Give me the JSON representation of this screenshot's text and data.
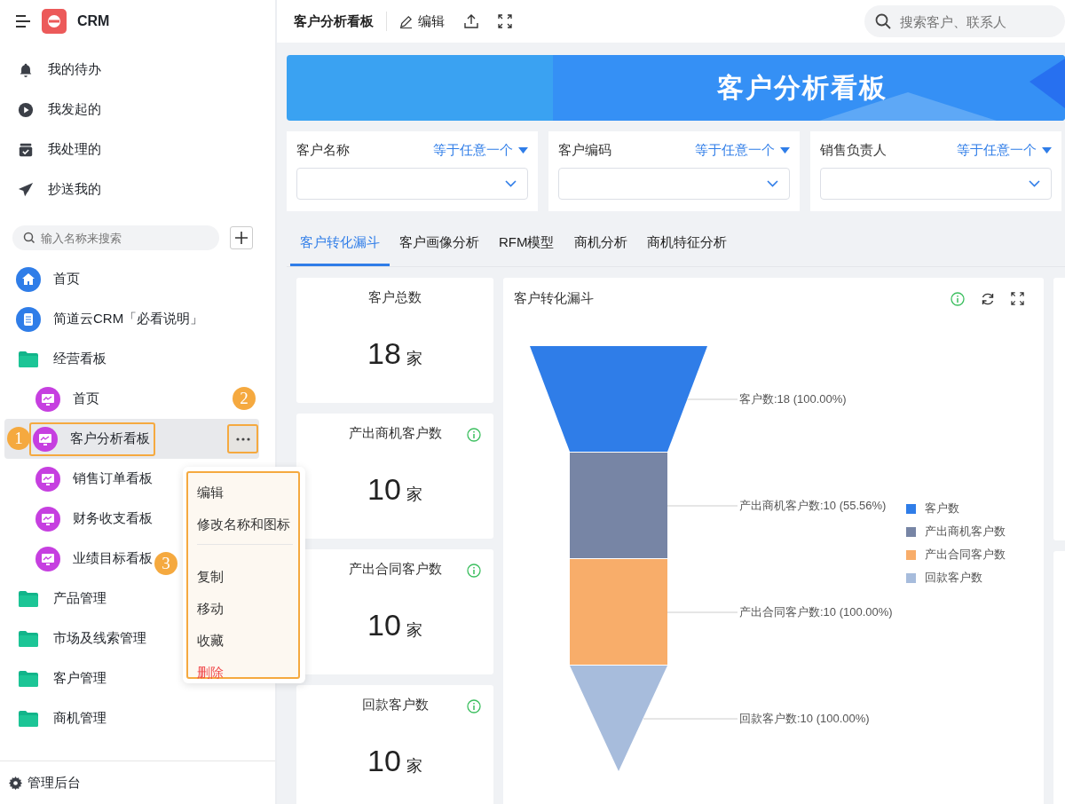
{
  "sidebar": {
    "app_name": "CRM",
    "quick_items": [
      {
        "label": "我的待办"
      },
      {
        "label": "我发起的"
      },
      {
        "label": "我处理的"
      },
      {
        "label": "抄送我的"
      }
    ],
    "search": {
      "placeholder": "输入名称来搜索"
    },
    "tree": [
      {
        "label": "首页",
        "kind": "home",
        "selected": false
      },
      {
        "label": "简道云CRM「必看说明」",
        "kind": "document",
        "selected": false
      },
      {
        "label": "经营看板",
        "kind": "folder",
        "selected": false,
        "children": [
          {
            "label": "首页",
            "kind": "board",
            "selected": false
          },
          {
            "label": "客户分析看板",
            "kind": "board",
            "selected": true,
            "callout": "1",
            "more_callout": "2"
          },
          {
            "label": "销售订单看板",
            "kind": "board",
            "selected": false
          },
          {
            "label": "财务收支看板",
            "kind": "board",
            "selected": false
          },
          {
            "label": "业绩目标看板",
            "kind": "board",
            "selected": false
          }
        ]
      },
      {
        "label": "产品管理",
        "kind": "folder",
        "selected": false
      },
      {
        "label": "市场及线索管理",
        "kind": "folder",
        "selected": false
      },
      {
        "label": "客户管理",
        "kind": "folder",
        "selected": false
      },
      {
        "label": "商机管理",
        "kind": "folder",
        "selected": false
      }
    ],
    "footer": "管理后台"
  },
  "context_menu": {
    "callout": "3",
    "items": [
      {
        "label": "编辑",
        "kind": "normal"
      },
      {
        "label": "修改名称和图标",
        "kind": "normal"
      },
      {
        "kind": "divider"
      },
      {
        "label": "复制",
        "kind": "normal"
      },
      {
        "label": "移动",
        "kind": "normal"
      },
      {
        "label": "收藏",
        "kind": "normal"
      },
      {
        "label": "删除",
        "kind": "danger"
      }
    ]
  },
  "topbar": {
    "title": "客户分析看板",
    "edit": "编辑",
    "search": {
      "placeholder": "搜索客户、联系人"
    }
  },
  "banner": {
    "title": "客户分析看板"
  },
  "filters": [
    {
      "label": "客户名称",
      "operator": "等于任意一个"
    },
    {
      "label": "客户编码",
      "operator": "等于任意一个"
    },
    {
      "label": "销售负责人",
      "operator": "等于任意一个"
    }
  ],
  "tabs": [
    {
      "label": "客户转化漏斗",
      "selected": true
    },
    {
      "label": "客户画像分析",
      "selected": false
    },
    {
      "label": "RFM模型",
      "selected": false
    },
    {
      "label": "商机分析",
      "selected": false
    },
    {
      "label": "商机特征分析",
      "selected": false
    }
  ],
  "stats": [
    {
      "title": "客户总数",
      "value": "18",
      "unit": "家",
      "info": false
    },
    {
      "title": "产出商机客户数",
      "value": "10",
      "unit": "家",
      "info": true
    },
    {
      "title": "产出合同客户数",
      "value": "10",
      "unit": "家",
      "info": true
    },
    {
      "title": "回款客户数",
      "value": "10",
      "unit": "家",
      "info": true
    }
  ],
  "funnel": {
    "title": "客户转化漏斗",
    "stages": [
      {
        "name": "客户数",
        "label": "客户数:18 (100.00%)",
        "color": "#2f7de8"
      },
      {
        "name": "产出商机客户数",
        "label": "产出商机客户数:10 (55.56%)",
        "color": "#7785a5"
      },
      {
        "name": "产出合同客户数",
        "label": "产出合同客户数:10 (100.00%)",
        "color": "#f8ad6a"
      },
      {
        "name": "回款客户数",
        "label": "回款客户数:10 (100.00%)",
        "color": "#a7bcdc"
      }
    ]
  }
}
